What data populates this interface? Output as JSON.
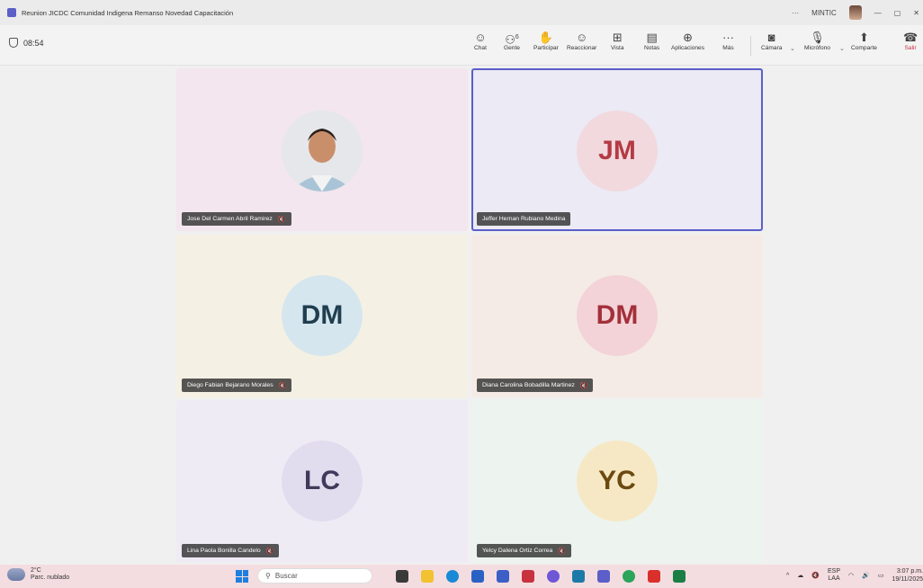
{
  "window": {
    "title": "Reunion JICDC Comunidad Indigena Remanso Novedad Capacitación",
    "account": "MINTIC"
  },
  "meeting": {
    "timer": "08:54"
  },
  "toolbar": {
    "chat": "Chat",
    "people": "Gente",
    "people_count": "6",
    "raise": "Participar",
    "react": "Reaccionar",
    "view": "Vista",
    "notes": "Notas",
    "apps": "Aplicaciones",
    "more": "Más",
    "camera": "Cámara",
    "mic": "Micrófono",
    "share": "Comparte",
    "leave": "Salir"
  },
  "participants": [
    {
      "name": "Jose Del Carmen Abril Ramirez",
      "initials": "",
      "muted": true,
      "bg": "#f3e6ee",
      "avatar_bg": "",
      "text_color": ""
    },
    {
      "name": "Jeffer Hernan Rubiano Medina",
      "initials": "JM",
      "muted": false,
      "bg": "#ebeaf5",
      "avatar_bg": "#f2d9de",
      "text_color": "#b33a44"
    },
    {
      "name": "Diego Fabian Bejarano Morales",
      "initials": "DM",
      "muted": true,
      "bg": "#f4f1e4",
      "avatar_bg": "#d6e6ee",
      "text_color": "#1f3e4f"
    },
    {
      "name": "Diana Carolina Bobadilla Martinez",
      "initials": "DM",
      "muted": true,
      "bg": "#f5ebe6",
      "avatar_bg": "#f3d3d7",
      "text_color": "#a3303b"
    },
    {
      "name": "Lina Paola Bonilla Candelo",
      "initials": "LC",
      "muted": true,
      "bg": "#efebf5",
      "avatar_bg": "#e2dcef",
      "text_color": "#3f3b5a"
    },
    {
      "name": "Yelcy Dalena Ortiz Correa",
      "initials": "YC",
      "muted": true,
      "bg": "#edf3ee",
      "avatar_bg": "#f7e8c5",
      "text_color": "#6b4a10"
    }
  ],
  "taskbar": {
    "temperature": "2°C",
    "weather": "Parc. nublado",
    "search": "Buscar",
    "lang_top": "ESP",
    "lang_bottom": "LAA",
    "time": "3:07 p.m.",
    "date": "19/11/2025"
  },
  "colors": {
    "accent": "#5b5fc7",
    "leave": "#c4314b"
  },
  "icons": [
    "teams-icon",
    "shield-icon",
    "chat-icon",
    "people-icon",
    "hand-icon",
    "emoji-icon",
    "view-icon",
    "notes-icon",
    "apps-icon",
    "more-icon",
    "camera-icon",
    "mic-icon",
    "share-icon",
    "phone-icon",
    "mute-icon",
    "windows-icon",
    "search-icon"
  ]
}
